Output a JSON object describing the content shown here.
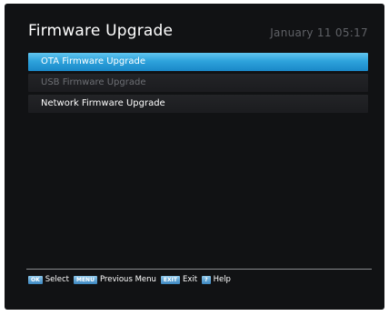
{
  "header": {
    "title": "Firmware Upgrade",
    "clock": "January 11 05:17"
  },
  "menu": {
    "items": [
      {
        "label": "OTA Firmware Upgrade",
        "state": "selected"
      },
      {
        "label": "USB Firmware Upgrade",
        "state": "disabled"
      },
      {
        "label": "Network Firmware Upgrade",
        "state": "normal"
      }
    ]
  },
  "footer": {
    "ok_key": "OK",
    "ok_label": "Select",
    "menu_key": "MENU",
    "menu_label": "Previous Menu",
    "exit_key": "EXIT",
    "exit_label": "Exit",
    "help_key": "?",
    "help_label": "Help"
  },
  "colors": {
    "background": "#111214",
    "selected": "#2ea3dc",
    "disabled_text": "#6d6f74",
    "key_badge": "#3b86c0"
  }
}
